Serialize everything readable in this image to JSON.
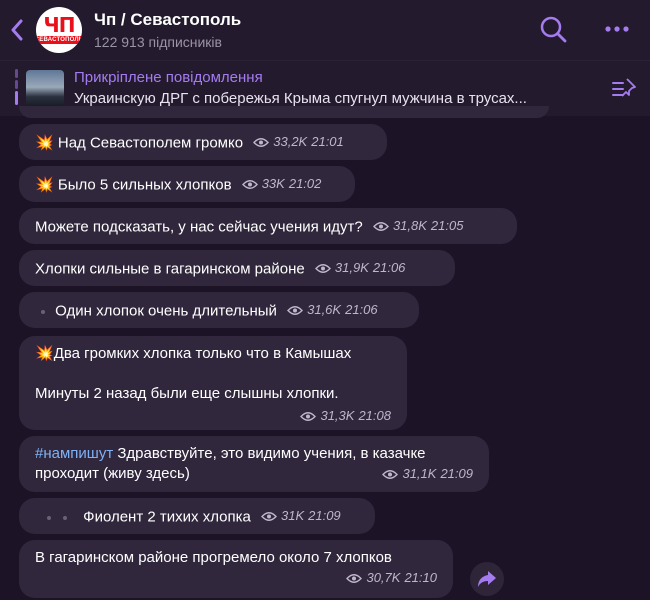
{
  "header": {
    "channel_title": "Чп / Севастополь",
    "subscribers": "122 913 підписників",
    "avatar_main": "ЧП",
    "avatar_sub": "СЕВАСТОПОЛЬ",
    "accent_color": "#a57cf0"
  },
  "pinned": {
    "title": "Прикріплене повідомлення",
    "text": "Украинскую ДРГ с побережья Крыма спугнул мужчина в трусах..."
  },
  "messages": [
    {
      "text": "Над Севастополем громко",
      "emoji": "💥",
      "views": "33,2K",
      "time": "21:01"
    },
    {
      "text": "Было 5 сильных хлопков",
      "emoji": "💥",
      "views": "33K",
      "time": "21:02"
    },
    {
      "text": "Можете подсказать, у нас сейчас учения идут?",
      "views": "31,8K",
      "time": "21:05"
    },
    {
      "text": "Хлопки сильные в гагаринском районе",
      "views": "31,9K",
      "time": "21:06"
    },
    {
      "text": "Один хлопок очень длительный",
      "views": "31,6K",
      "time": "21:06"
    },
    {
      "line1": "Два громких хлопка только что в Камышах",
      "emoji": "💥",
      "line2": "Минуты 2 назад были еще слышны хлопки.",
      "views": "31,3K",
      "time": "21:08"
    },
    {
      "hashtag": "#нампишут",
      "line1": " Здравствуйте, это видимо учения, в казачке",
      "line2": "проходит (живу здесь)",
      "views": "31,1K",
      "time": "21:09"
    },
    {
      "text": "Фиолент 2 тихих хлопка",
      "views": "31K",
      "time": "21:09"
    },
    {
      "text": "В гагаринском районе прогремело около 7 хлопков",
      "views": "30,7K",
      "time": "21:10"
    }
  ]
}
